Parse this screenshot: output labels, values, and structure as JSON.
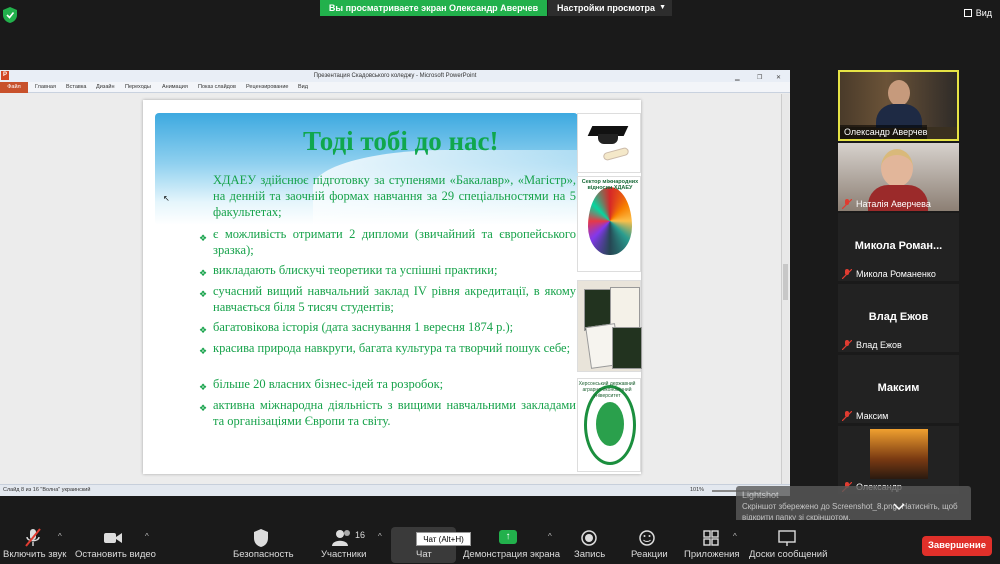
{
  "topbar": {
    "banner": "Вы просматриваете экран Олександр Аверчев",
    "view_options": "Настройки просмотра",
    "view_button": "Вид"
  },
  "powerpoint": {
    "window_title": "Презентация Скадовського коледжу - Microsoft PowerPoint",
    "tabs": [
      "Файл",
      "Главная",
      "Вставка",
      "Дизайн",
      "Переходы",
      "Анимация",
      "Показ слайдов",
      "Рецензирование",
      "Вид"
    ],
    "status_left": "Слайд 8 из 16   \"Волна\"   украинский",
    "zoom": "101%"
  },
  "slide": {
    "title": "Тоді тобі до нас!",
    "intro": "ХДАЕУ  здійснює підготовку за ступенями «Бакалавр», «Магістр», на денній та заочній формах навчання за 29 спеціальностями на 5 факультетах;",
    "bullets": [
      "є можливість отримати 2 дипломи (звичайний та європейського зразка);",
      "викладають блискучі теоретики та успішні практики;",
      "сучасний вищий навчальний заклад IV рівня акредитації, в якому навчається біля 5 тисяч студентів;",
      "багатовікова історія (дата заснування 1 вересня 1874 р.);",
      "красива природа навкруги, багата культура та творчий пошук себе;",
      "більше 20 власних бізнес-ідей та  розробок;",
      "активна міжнародна діяльність з вищими навчальними закладами та організаціями Європи та світу."
    ],
    "globe_caption": "Сектор міжнародних відносин ХДАЕУ",
    "logo_caption": "Херсонський державний аграрно-економічний університет"
  },
  "participants": [
    {
      "name": "Олександр Аверчев",
      "video": true,
      "active": true
    },
    {
      "name": "Наталія Аверчева",
      "video": true,
      "muted": true
    },
    {
      "name": "Микола Романенко",
      "display": "Микола  Роман...",
      "muted": true
    },
    {
      "name": "Влад Ежов",
      "display": "Влад Ежов",
      "muted": true
    },
    {
      "name": "Максим",
      "display": "Максим",
      "muted": true
    },
    {
      "name": "Олександр",
      "video": true,
      "muted": true
    }
  ],
  "toolbar": {
    "mute": "Включить звук",
    "video": "Остановить видео",
    "security": "Безопасность",
    "participants": "Участники",
    "participants_count": "16",
    "chat": "Чат",
    "chat_tooltip": "Чат (Alt+H)",
    "share": "Демонстрация экрана",
    "record": "Запись",
    "reactions": "Реакции",
    "apps": "Приложения",
    "whiteboards": "Доски сообщений",
    "end": "Завершение"
  },
  "toast": {
    "title": "Lightshot",
    "text": "Скріншот збережено до Screenshot_8.png. Натисніть, щоб відкрити папку зі скріншотом."
  },
  "colors": {
    "accent_green": "#22b14c",
    "slide_green": "#16a24a",
    "end_red": "#e0302a",
    "active_border": "#e6e345"
  }
}
